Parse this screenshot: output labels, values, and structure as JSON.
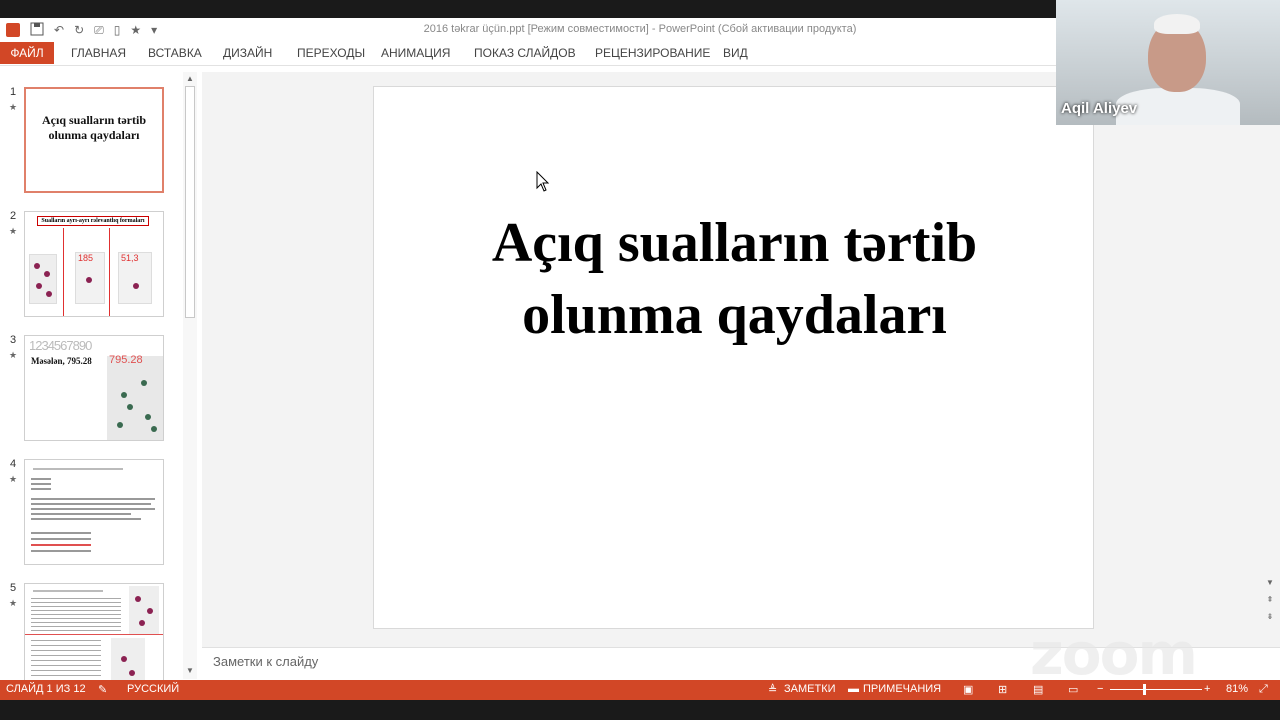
{
  "window": {
    "title": "2016 təkrar üçün.ppt [Режим совместимости] - PowerPoint (Сбой активации продукта)"
  },
  "ribbon": {
    "tabs": [
      "ФАЙЛ",
      "ГЛАВНАЯ",
      "ВСТАВКА",
      "ДИЗАЙН",
      "ПЕРЕХОДЫ",
      "АНИМАЦИЯ",
      "ПОКАЗ СЛАЙДОВ",
      "РЕЦЕНЗИРОВАНИЕ",
      "ВИД"
    ]
  },
  "thumbnails": [
    {
      "num": "1",
      "star": "★",
      "title": "Açıq sualların tərtib olunma qaydaları"
    },
    {
      "num": "2",
      "star": "★",
      "title": "Sualların ayrı-ayrı rəlevantlıq formaları",
      "numbers": [
        "185",
        "51,3"
      ]
    },
    {
      "num": "3",
      "star": "★",
      "title": "Məsələn, 795.28",
      "digits": "1234567890",
      "number": "795.28"
    },
    {
      "num": "4",
      "star": "★"
    },
    {
      "num": "5",
      "star": "★"
    }
  ],
  "slide": {
    "title_line1": "Açıq sualların tərtib",
    "title_line2": "olunma qaydaları"
  },
  "notes": {
    "placeholder": "Заметки к слайду"
  },
  "statusbar": {
    "slide_counter": "СЛАЙД 1 ИЗ 12",
    "language": "РУССКИЙ",
    "notes_label": "ЗАМЕТКИ",
    "comments_label": "ПРИМЕЧАНИЯ",
    "zoom_level": "81%"
  },
  "video": {
    "participant_name": "Aqil Aliyev"
  },
  "watermark": {
    "text": "zoom"
  },
  "colors": {
    "accent": "#d24726",
    "selection_border": "#e0806a"
  }
}
